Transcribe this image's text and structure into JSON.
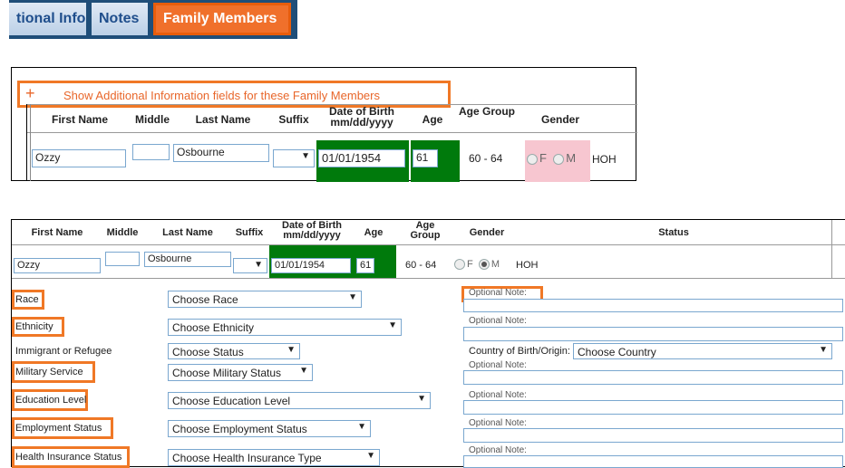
{
  "tabs": [
    {
      "label": "tional Info"
    },
    {
      "label": "Notes"
    },
    {
      "label": "Family Members"
    }
  ],
  "panel1": {
    "show_more": {
      "plus": "+",
      "text": "Show Additional Information fields for these Family Members"
    },
    "headers": {
      "first": "First Name",
      "middle": "Middle",
      "last": "Last Name",
      "suffix": "Suffix",
      "dob": "Date of Birth",
      "dob_fmt": "mm/dd/yyyy",
      "age": "Age",
      "age_group": "Age Group",
      "gender": "Gender"
    },
    "row": {
      "first": "Ozzy",
      "middle": "",
      "last": "Osbourne",
      "suffix": "",
      "dob": "01/01/1954",
      "age": "61",
      "age_group": "60 - 64",
      "gender_f": "F",
      "gender_m": "M",
      "relation": "HOH"
    }
  },
  "panel2": {
    "headers": {
      "first": "First Name",
      "middle": "Middle",
      "last": "Last Name",
      "suffix": "Suffix",
      "dob": "Date of Birth",
      "dob_fmt": "mm/dd/yyyy",
      "age": "Age",
      "age_group": "Age Group",
      "gender": "Gender",
      "status": "Status"
    },
    "row": {
      "first": "Ozzy",
      "middle": "",
      "last": "Osbourne",
      "suffix": "",
      "dob": "01/01/1954",
      "age": "61",
      "age_group": "60 - 64",
      "gender_f": "F",
      "gender_m": "M",
      "relation": "HOH"
    },
    "fields": [
      {
        "label": "Race",
        "select": "Choose Race",
        "note": "Optional Note:"
      },
      {
        "label": "Ethnicity",
        "select": "Choose Ethnicity",
        "note": "Optional Note:"
      },
      {
        "label": "Immigrant or Refugee",
        "select": "Choose Status",
        "country_label": "Country of Birth/Origin:",
        "country_select": "Choose Country",
        "note": "Optional Note:"
      },
      {
        "label": "Military Service",
        "select": "Choose Military Status"
      },
      {
        "label": "Education Level",
        "select": "Choose Education Level",
        "note": "Optional Note:"
      },
      {
        "label": "Employment Status",
        "select": "Choose Employment Status",
        "note": "Optional Note:"
      },
      {
        "label": "Health Insurance Status",
        "select": "Choose Health Insurance Type",
        "note": "Optional Note:"
      }
    ]
  },
  "colors": {
    "accent": "#f07826",
    "tab_bg": "#1f4e79",
    "age_bg": "#007a0c",
    "gender_bg": "#f7c6d0"
  }
}
